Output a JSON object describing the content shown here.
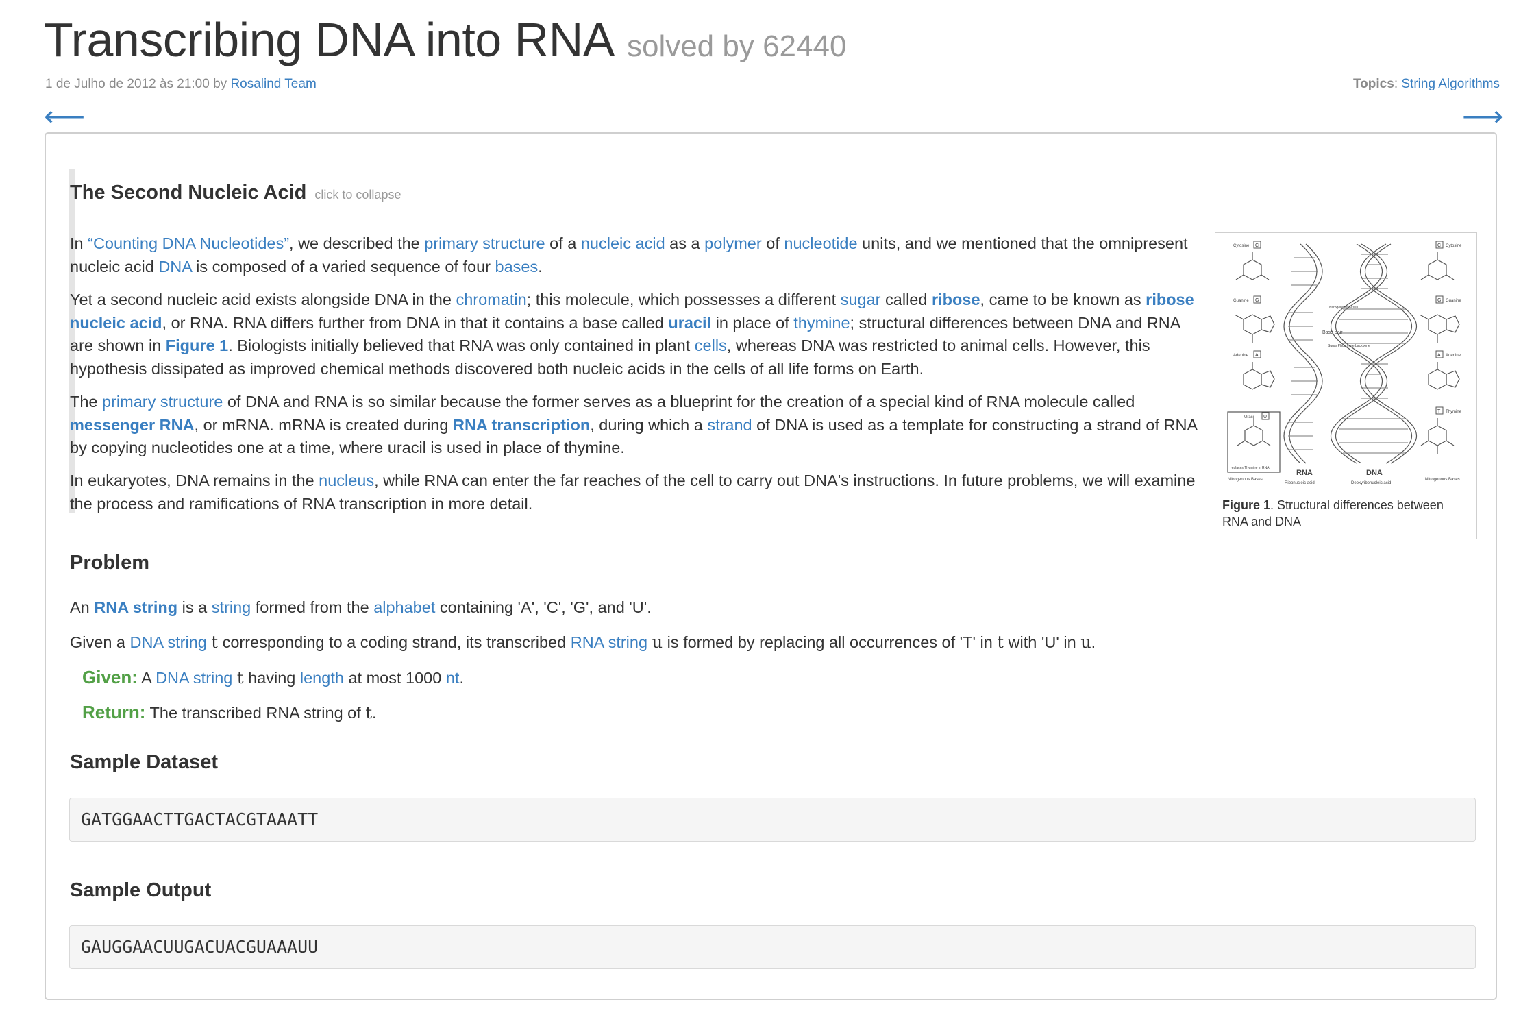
{
  "header": {
    "title": "Transcribing DNA into RNA",
    "solved": "solved by 62440",
    "date": "1 de Julho de 2012 às 21:00 by ",
    "author": "Rosalind Team",
    "topics_label": "Topics",
    "topics_colon": ": ",
    "topic": "String Algorithms",
    "prev_arrow": "⟵",
    "next_arrow": "⟶"
  },
  "intro": {
    "title": "The Second Nucleic Acid",
    "collapse": "click to collapse",
    "p1": [
      {
        "t": "In "
      },
      {
        "t": "“Counting DNA Nucleotides”",
        "link": true
      },
      {
        "t": ", we described the "
      },
      {
        "t": "primary structure",
        "link": true
      },
      {
        "t": " of a "
      },
      {
        "t": "nucleic acid",
        "link": true
      },
      {
        "t": " as a "
      },
      {
        "t": "polymer",
        "link": true
      },
      {
        "t": " of "
      },
      {
        "t": "nucleotide",
        "link": true
      },
      {
        "t": " units, and we mentioned that the omnipresent nucleic acid "
      },
      {
        "t": "DNA",
        "link": true
      },
      {
        "t": " is composed of a varied sequence of four "
      },
      {
        "t": "bases",
        "link": true
      },
      {
        "t": "."
      }
    ],
    "p2": [
      {
        "t": "Yet a second nucleic acid exists alongside DNA in the "
      },
      {
        "t": "chromatin",
        "link": true
      },
      {
        "t": "; this molecule, which possesses a different "
      },
      {
        "t": "sugar",
        "link": true
      },
      {
        "t": " called "
      },
      {
        "t": "ribose",
        "link": true,
        "bold": true
      },
      {
        "t": ", came to be known as "
      },
      {
        "t": "ribose nucleic acid",
        "link": true,
        "bold": true
      },
      {
        "t": ", or RNA. RNA differs further from DNA in that it contains a base called "
      },
      {
        "t": "uracil",
        "link": true,
        "bold": true
      },
      {
        "t": " in place of "
      },
      {
        "t": "thymine",
        "link": true
      },
      {
        "t": "; structural differences between DNA and RNA are shown in "
      },
      {
        "t": "Figure 1",
        "link": true,
        "bold": true
      },
      {
        "t": ". Biologists initially believed that RNA was only contained in plant "
      },
      {
        "t": "cells",
        "link": true
      },
      {
        "t": ", whereas DNA was restricted to animal cells. However, this hypothesis dissipated as improved chemical methods discovered both nucleic acids in the cells of all life forms on Earth."
      }
    ],
    "p3": [
      {
        "t": "The "
      },
      {
        "t": "primary structure",
        "link": true
      },
      {
        "t": " of DNA and RNA is so similar because the former serves as a blueprint for the creation of a special kind of RNA molecule called "
      },
      {
        "t": "messenger RNA",
        "link": true,
        "bold": true
      },
      {
        "t": ", or mRNA. mRNA is created during "
      },
      {
        "t": "RNA transcription",
        "link": true,
        "bold": true
      },
      {
        "t": ", during which a "
      },
      {
        "t": "strand",
        "link": true
      },
      {
        "t": " of DNA is used as a template for constructing a strand of RNA by copying nucleotides one at a time, where uracil is used in place of thymine."
      }
    ],
    "p4": [
      {
        "t": "In eukaryotes, DNA remains in the "
      },
      {
        "t": "nucleus",
        "link": true
      },
      {
        "t": ", while RNA can enter the far reaches of the cell to carry out DNA's instructions. In future problems, we will examine the process and ramifications of RNA transcription in more detail."
      }
    ]
  },
  "figure": {
    "caption_bold": "Figure 1",
    "caption": ". Structural differences between RNA and DNA",
    "labels": {
      "cytosine": "Cytosine",
      "guanine": "Guanine",
      "adenine": "Adenine",
      "uracil": "Uracil",
      "thymine": "Thymine",
      "rna": "RNA",
      "dna": "DNA",
      "rna_full": "Ribonucleic acid",
      "dna_full": "Deoxyribonucleic acid",
      "bases": "Nitrogenous Bases",
      "base_pair": "Base pair",
      "backbone": "Sugar Phosphate backbone",
      "replaces": "replaces Thymine in RNA",
      "nitro_left": "Nitrogenous Bases",
      "nitro_right": "Nitrogenous Bases",
      "c": "C",
      "g": "G",
      "a": "A",
      "u": "U",
      "t": "T"
    }
  },
  "problem": {
    "heading": "Problem",
    "line1": [
      {
        "t": "An "
      },
      {
        "t": "RNA string",
        "link": true,
        "bold": true
      },
      {
        "t": " is a "
      },
      {
        "t": "string",
        "link": true
      },
      {
        "t": " formed from the "
      },
      {
        "t": "alphabet",
        "link": true
      },
      {
        "t": " containing 'A', 'C', 'G', and 'U'."
      }
    ],
    "line2": [
      {
        "t": "Given a "
      },
      {
        "t": "DNA string",
        "link": true
      },
      {
        "t": " "
      },
      {
        "t": "t",
        "math": true
      },
      {
        "t": " corresponding to a coding strand, its transcribed "
      },
      {
        "t": "RNA string",
        "link": true
      },
      {
        "t": " "
      },
      {
        "t": "u",
        "math": true
      },
      {
        "t": " is formed by replacing all occurrences of 'T' in "
      },
      {
        "t": "t",
        "math": true
      },
      {
        "t": " with 'U' in "
      },
      {
        "t": "u",
        "math": true
      },
      {
        "t": "."
      }
    ],
    "given_label": "Given:",
    "given": [
      {
        "t": " A "
      },
      {
        "t": "DNA string",
        "link": true
      },
      {
        "t": " "
      },
      {
        "t": "t",
        "math": true
      },
      {
        "t": " having "
      },
      {
        "t": "length",
        "link": true
      },
      {
        "t": " at most 1000 "
      },
      {
        "t": "nt",
        "link": true
      },
      {
        "t": "."
      }
    ],
    "return_label": "Return:",
    "return": [
      {
        "t": " The transcribed RNA string of "
      },
      {
        "t": "t",
        "math": true
      },
      {
        "t": "."
      }
    ]
  },
  "sample_dataset": {
    "heading": "Sample Dataset",
    "value": "GATGGAACTTGACTACGTAAATT"
  },
  "sample_output": {
    "heading": "Sample Output",
    "value": "GAUGGAACUUGACUACGUAAAUU"
  }
}
